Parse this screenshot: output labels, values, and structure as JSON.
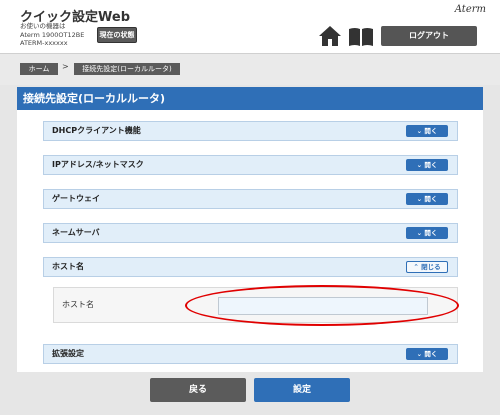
{
  "header": {
    "app_title": "クイック設定Web",
    "device_line1": "お使いの機器は",
    "device_line2": "Aterm 1900OT12BE",
    "device_line3": "ATERM-xxxxxx",
    "status_button": "現在の状態",
    "brand": "Aterm",
    "logout_button": "ログアウト"
  },
  "breadcrumb": {
    "home": "ホーム",
    "separator": ">",
    "current": "接続先設定(ローカルルータ)"
  },
  "page": {
    "title": "接続先設定(ローカルルータ)"
  },
  "sections": [
    {
      "label": "DHCPクライアント機能",
      "toggle": "開く"
    },
    {
      "label": "IPアドレス/ネットマスク",
      "toggle": "開く"
    },
    {
      "label": "ゲートウェイ",
      "toggle": "開く"
    },
    {
      "label": "ネームサーバ",
      "toggle": "開く"
    },
    {
      "label": "ホスト名",
      "toggle": "閉じる"
    },
    {
      "label": "拡張設定",
      "toggle": "開く"
    }
  ],
  "hostname_field": {
    "label": "ホスト名",
    "value": "",
    "placeholder": ""
  },
  "footer": {
    "back_button": "戻る",
    "save_button": "設定"
  },
  "colors": {
    "accent": "#2f6fb7",
    "section_bg": "#e1eef9",
    "dark_button": "#5b5b5b",
    "highlight": "#e00000"
  },
  "icons": {
    "home": "home-icon",
    "manual": "book-icon",
    "open": "chevron-down-icon",
    "close": "chevron-up-icon"
  }
}
